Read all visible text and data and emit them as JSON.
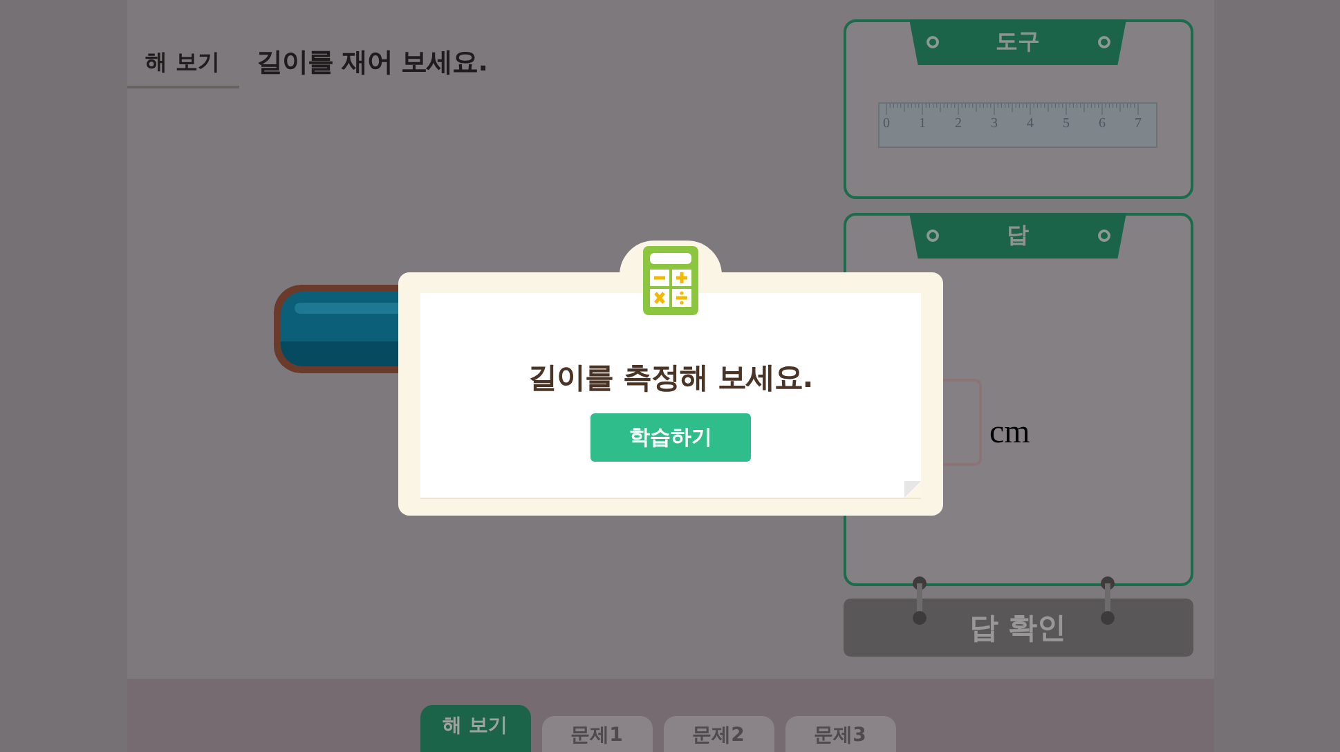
{
  "header": {
    "badge": "해 보기",
    "question": "길이를 재어 보세요."
  },
  "tool_panel": {
    "title": "도구",
    "ruler_numbers": [
      "0",
      "1",
      "2",
      "3",
      "4",
      "5",
      "6",
      "7"
    ]
  },
  "answer_panel": {
    "title": "답",
    "unit": "cm"
  },
  "check_button": {
    "label": "답 확인",
    "disabled": true
  },
  "dialog": {
    "message": "길이를 측정해 보세요.",
    "button": "학습하기"
  },
  "tabs": [
    {
      "label": "해 보기",
      "selected": true
    },
    {
      "label": "문제1",
      "selected": false
    },
    {
      "label": "문제2",
      "selected": false
    },
    {
      "label": "문제3",
      "selected": false
    }
  ]
}
